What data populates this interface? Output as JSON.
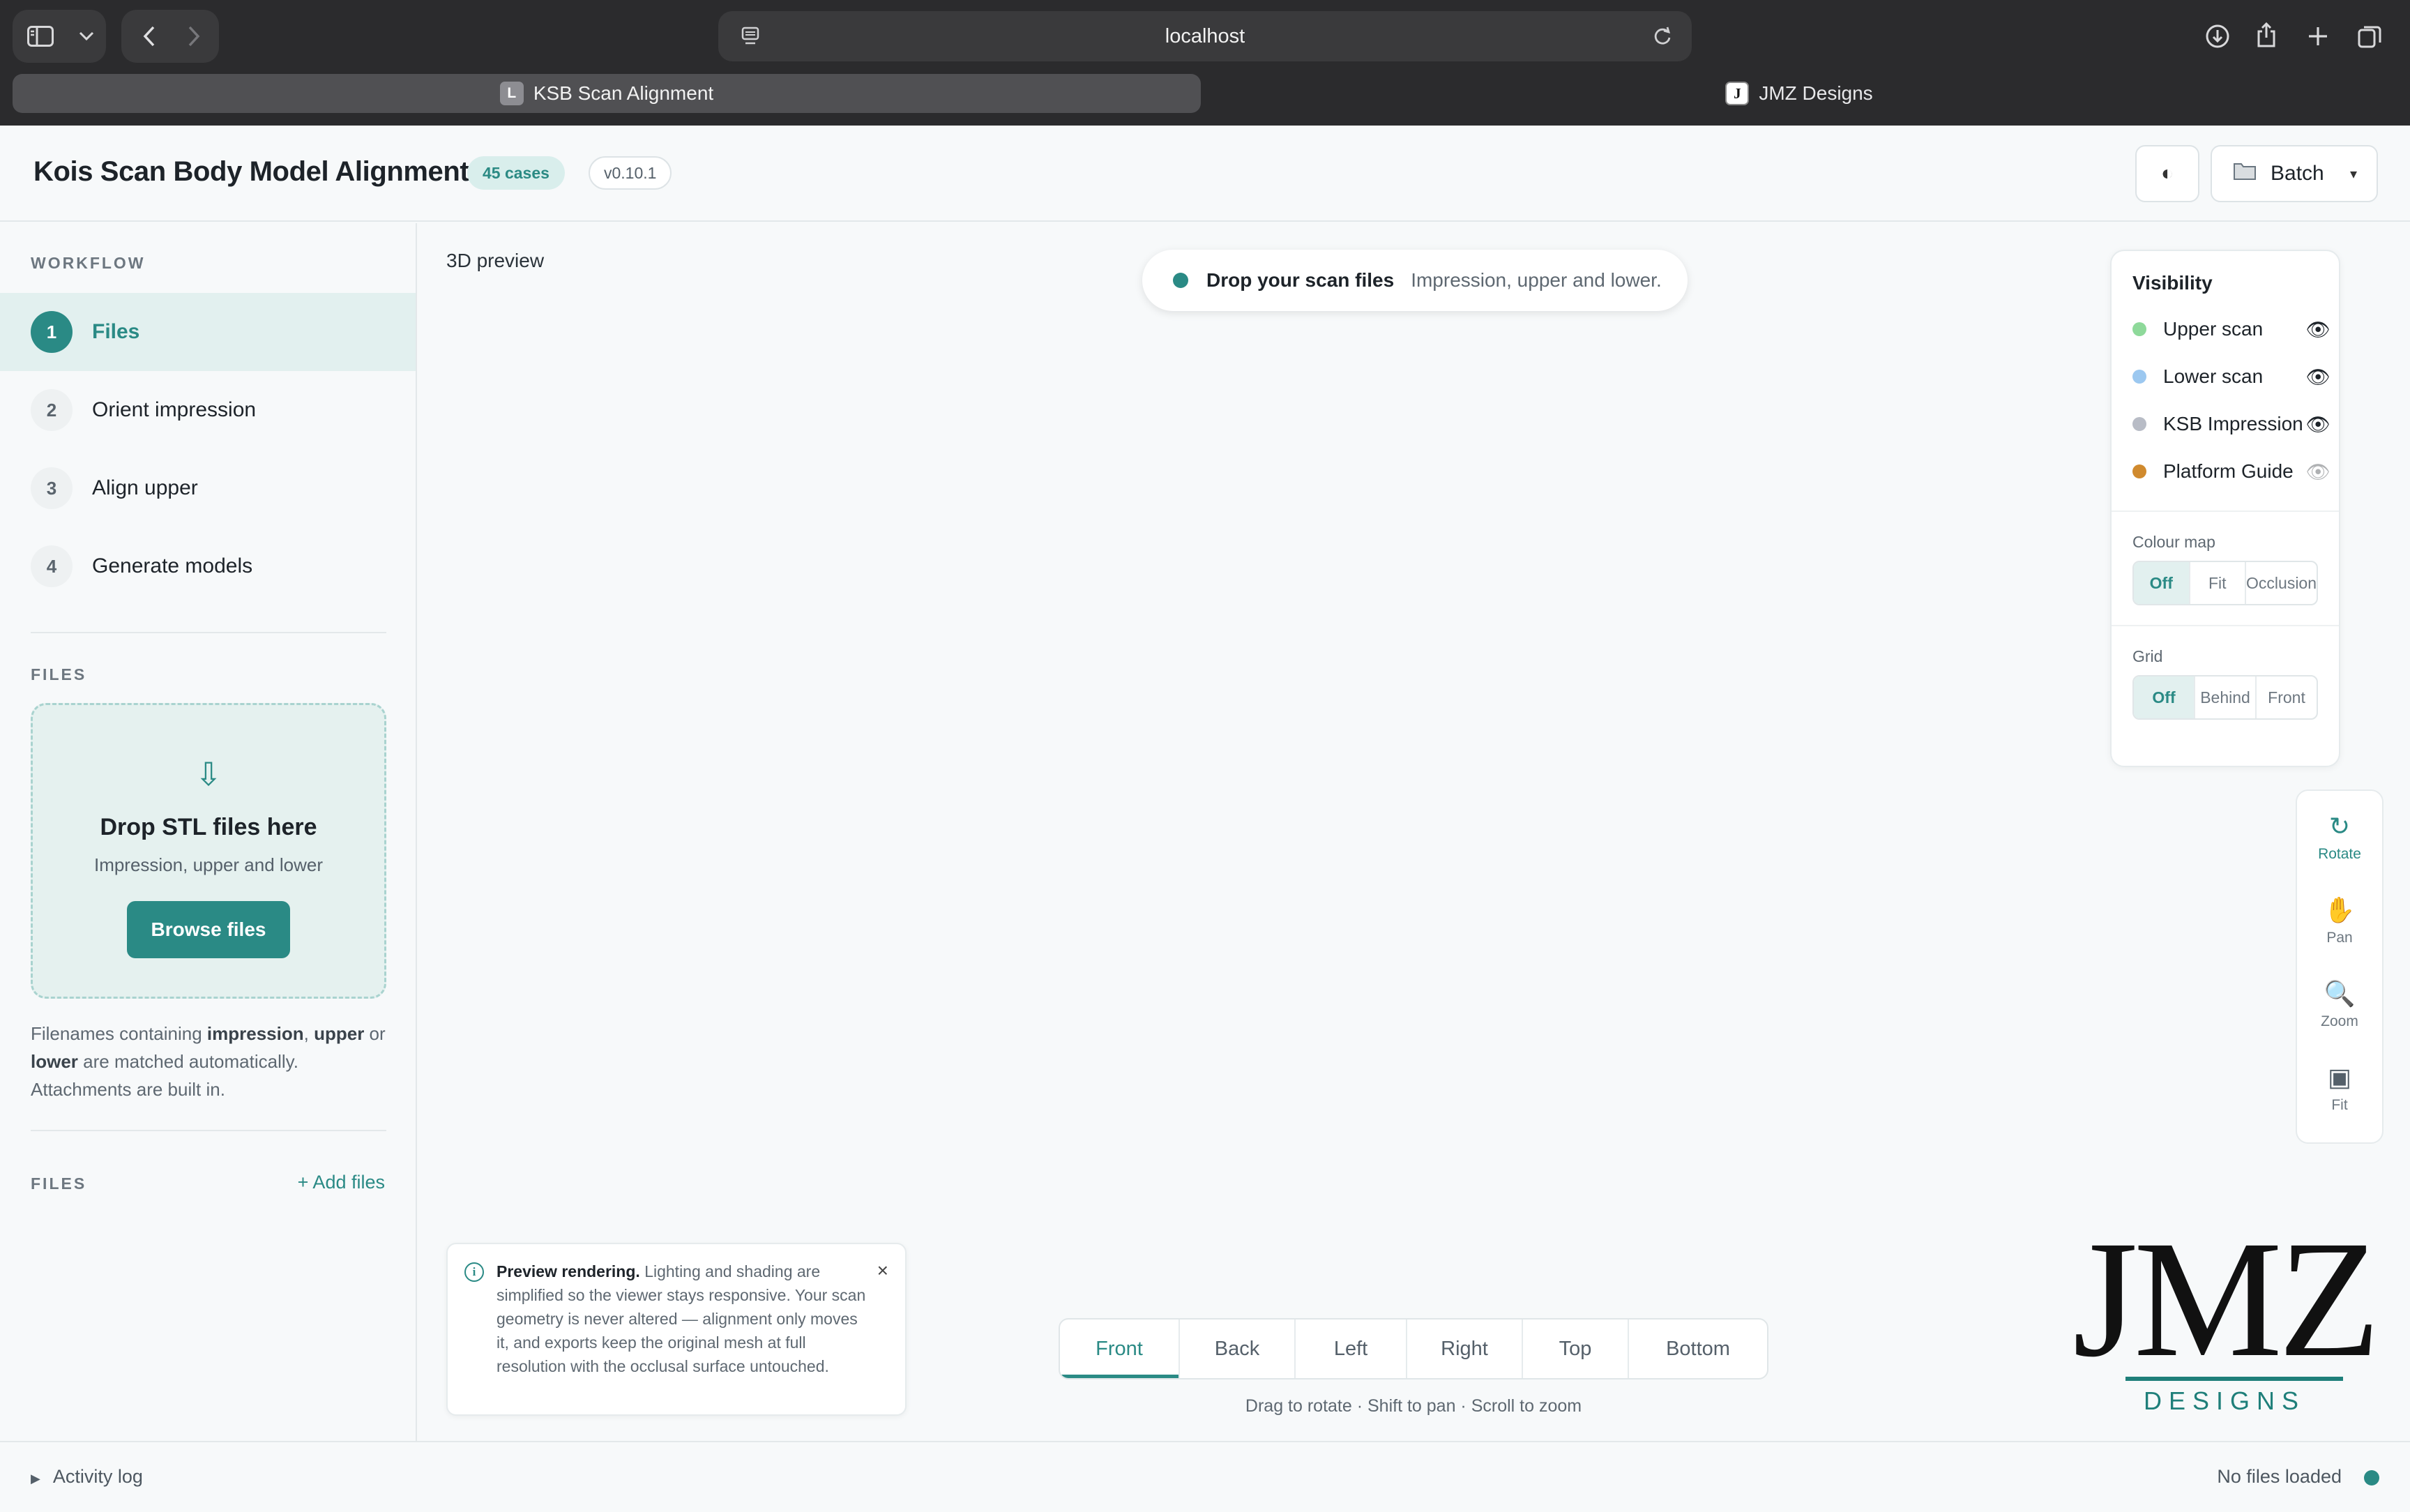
{
  "browser": {
    "address": "localhost",
    "tabs": [
      {
        "label": "KSB Scan Alignment",
        "favicon": "L"
      },
      {
        "label": "JMZ Designs",
        "favicon": "J"
      }
    ]
  },
  "header": {
    "title": "Kois Scan Body Model Alignment",
    "cases_badge": "45 cases",
    "version": "v0.10.1",
    "batch_label": "Batch",
    "batch_caret": "▾",
    "theme_icon": "◐"
  },
  "sidebar": {
    "workflow_label": "WORKFLOW",
    "steps": [
      {
        "num": "1",
        "label": "Files",
        "active": true
      },
      {
        "num": "2",
        "label": "Orient impression",
        "active": false
      },
      {
        "num": "3",
        "label": "Align upper",
        "active": false
      },
      {
        "num": "4",
        "label": "Generate models",
        "active": false
      }
    ],
    "files_label": "FILES",
    "dropzone": {
      "arrow": "⇩",
      "title": "Drop STL files here",
      "subtitle": "Impression, upper and lower",
      "button": "Browse files"
    },
    "hint": {
      "prefix": "Filenames containing ",
      "k1": "impression",
      "sep1": ", ",
      "k2": "upper",
      "sep2": " or ",
      "k3": "lower",
      "suffix": " are matched automatically. Attachments are built in."
    },
    "files_list_label": "FILES",
    "add_files": "+ Add files"
  },
  "viewport": {
    "preview_label": "3D preview",
    "drop_pill": {
      "title": "Drop your scan files",
      "subtitle": "Impression, upper and lower."
    },
    "visibility": {
      "title": "Visibility",
      "items": [
        {
          "label": "Upper scan",
          "color": "#8ed99a",
          "visible": true
        },
        {
          "label": "Lower scan",
          "color": "#9cc8f0",
          "visible": true
        },
        {
          "label": "KSB Impression",
          "color": "#b8bcc6",
          "visible": true
        },
        {
          "label": "Platform Guide",
          "color": "#d08a2e",
          "visible": false
        }
      ],
      "colour_map": {
        "label": "Colour map",
        "options": [
          "Off",
          "Fit",
          "Occlusion"
        ],
        "selected": "Off"
      },
      "grid": {
        "label": "Grid",
        "options": [
          "Off",
          "Behind",
          "Front"
        ],
        "selected": "Off"
      }
    },
    "tools": [
      {
        "label": "Rotate",
        "icon": "↻",
        "icon_name": "rotate-icon",
        "active": true
      },
      {
        "label": "Pan",
        "icon": "✋",
        "icon_name": "hand-icon",
        "active": false
      },
      {
        "label": "Zoom",
        "icon": "🔍",
        "icon_name": "magnifier-icon",
        "active": false
      },
      {
        "label": "Fit",
        "icon": "▣",
        "icon_name": "fit-icon",
        "active": false
      }
    ],
    "info": {
      "bold": "Preview rendering.",
      "text": " Lighting and shading are simplified so the viewer stays responsive. Your scan geometry is never altered — alignment only moves it, and exports keep the original mesh at full resolution with the occlusal surface untouched."
    },
    "view_tabs": [
      "Front",
      "Back",
      "Left",
      "Right",
      "Top",
      "Bottom"
    ],
    "active_view": "Front",
    "nav_hint": "Drag to rotate · Shift to pan · Scroll to zoom",
    "logo": {
      "mark": "JMZ",
      "sub": "DESIGNS"
    }
  },
  "status": {
    "activity_label": "Activity log",
    "status_text": "No files loaded",
    "accent": "#2a8a85"
  }
}
